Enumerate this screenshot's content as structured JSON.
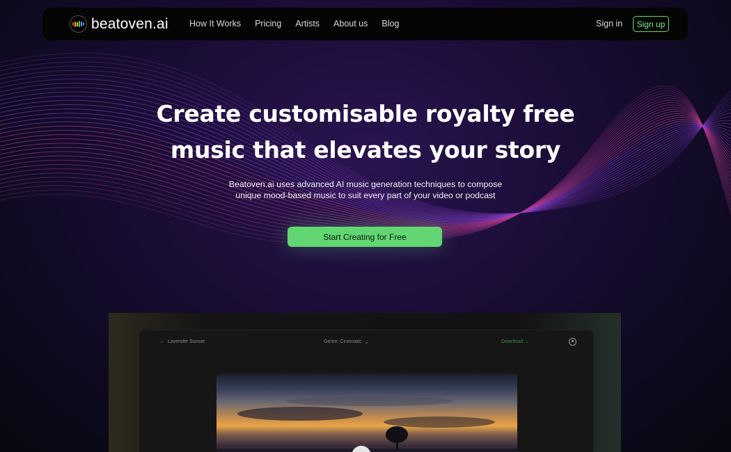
{
  "nav": {
    "logo_text": "beatoven.ai",
    "links": [
      "How It Works",
      "Pricing",
      "Artists",
      "About us",
      "Blog"
    ],
    "sign_in": "Sign in",
    "sign_up": "Sign up"
  },
  "hero": {
    "title_line1": "Create customisable royalty free",
    "title_line2": "music that elevates your story",
    "subtitle": "Beatoven.ai uses advanced AI music generation techniques to compose unique mood-based music to suit every part of your video or podcast",
    "cta": "Start Creating for Free"
  },
  "preview": {
    "back_label": "Lavender Sunset",
    "genre_label": "Genre: Cinematic",
    "download_label": "Download"
  },
  "colors": {
    "accent_green": "#62d673",
    "wave_purple": "#8a3fd0",
    "wave_magenta": "#c0409a"
  }
}
